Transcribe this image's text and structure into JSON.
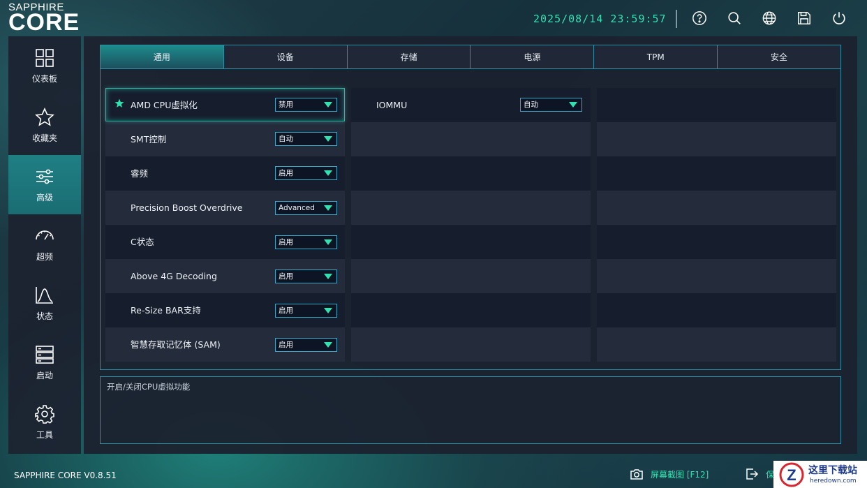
{
  "header": {
    "logo_top": "SAPPHIRE",
    "logo_main": "CORE",
    "datetime": "2025/08/14 23:59:57",
    "icons": [
      "help-icon",
      "search-icon",
      "globe-icon",
      "save-icon",
      "power-icon"
    ]
  },
  "sidebar": {
    "items": [
      {
        "label": "仪表板",
        "icon": "dashboard-icon"
      },
      {
        "label": "收藏夹",
        "icon": "star-icon"
      },
      {
        "label": "高级",
        "icon": "sliders-icon",
        "active": true
      },
      {
        "label": "超频",
        "icon": "gauge-icon"
      },
      {
        "label": "状态",
        "icon": "chart-icon"
      },
      {
        "label": "启动",
        "icon": "server-icon"
      },
      {
        "label": "工具",
        "icon": "gear-icon"
      }
    ]
  },
  "tabs": [
    "通用",
    "设备",
    "存储",
    "电源",
    "TPM",
    "安全"
  ],
  "active_tab": "通用",
  "settings_col1": [
    {
      "label": "AMD CPU虚拟化",
      "value": "禁用",
      "favorite": true
    },
    {
      "label": "SMT控制",
      "value": "自动"
    },
    {
      "label": "睿频",
      "value": "启用"
    },
    {
      "label": "Precision Boost Overdrive",
      "value": "Advanced"
    },
    {
      "label": "C状态",
      "value": "启用"
    },
    {
      "label": "Above 4G Decoding",
      "value": "启用"
    },
    {
      "label": "Re-Size BAR支持",
      "value": "启用"
    },
    {
      "label": "智慧存取记忆体 (SAM)",
      "value": "启用"
    }
  ],
  "settings_col2": [
    {
      "label": "IOMMU",
      "value": "自动"
    }
  ],
  "description": "开启/关闭CPU虚拟功能",
  "footer": {
    "version": "SAPPHIRE CORE V0.8.51",
    "screenshot_label": "屏幕截图 [F12]",
    "save_exit_label": "保"
  },
  "watermark": {
    "title": "这里下载站",
    "url": "heredown.com"
  },
  "colors": {
    "accent": "#2fe2b0",
    "border": "#2d8fa6",
    "active_nav": "#1f7f83"
  }
}
